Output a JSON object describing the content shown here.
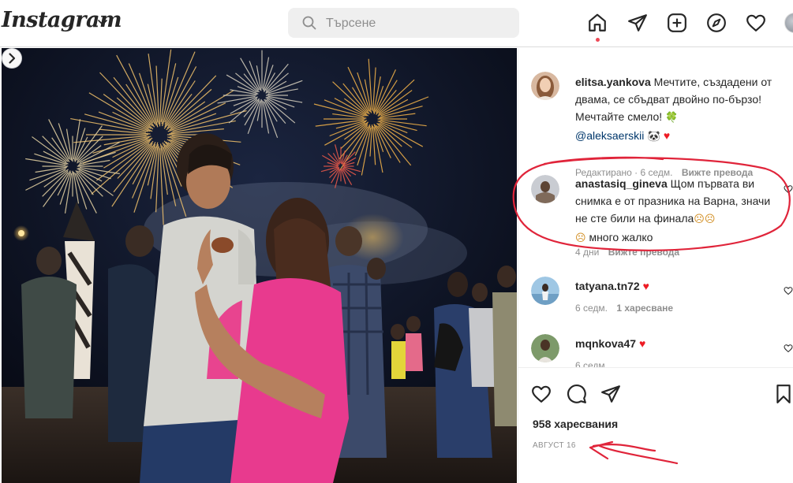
{
  "app": {
    "name": "Instagram"
  },
  "search": {
    "placeholder": "Търсене"
  },
  "nav": {
    "icons": [
      "home-icon",
      "direct-message-icon",
      "new-post-icon",
      "explore-icon",
      "activity-heart-icon",
      "profile-avatar"
    ]
  },
  "comments": [
    {
      "user": "elitsa.yankova",
      "text": "Мечтите, създадени от двама, се сбъдват двойно по-бързо! Мечтайте смело! ",
      "clover": "🍀",
      "mention": "@aleksaerskii",
      "emojis_after": " 🐼 ",
      "heart": "♥",
      "edited": "Редактирано",
      "time": "6 седм.",
      "translate": "Вижте превода"
    },
    {
      "user": "anastasiq_gineva",
      "text": "Щом първата ви снимка е от празника на Варна, значи не сте били на финала",
      "emojis": "☹☹ ",
      "emoji2": "☹",
      "text2": " много жалко",
      "time": "4 дни",
      "translate": "Вижте превода"
    },
    {
      "user": "tatyana.tn72",
      "heart": "♥",
      "time": "6 седм.",
      "likes": "1 харесване"
    },
    {
      "user": "mqnkova47",
      "heart": "♥",
      "time": "6 седм."
    }
  ],
  "post": {
    "likes": "958 харесвания",
    "date": "АВГУСТ 16"
  },
  "colors": {
    "accent_red": "#ed4956",
    "heart_red": "#ed1c24",
    "annotation_red": "#e0243a",
    "mention_blue": "#00376b",
    "muted_gray": "#8e8e8e"
  }
}
